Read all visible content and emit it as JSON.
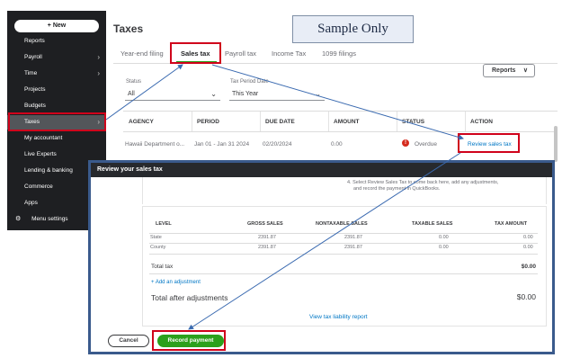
{
  "sidebar": {
    "new_label": "+ New",
    "items": [
      {
        "label": "Reports",
        "chevron": false
      },
      {
        "label": "Payroll",
        "chevron": true
      },
      {
        "label": "Time",
        "chevron": true
      },
      {
        "label": "Projects",
        "chevron": false
      },
      {
        "label": "Budgets",
        "chevron": false
      },
      {
        "label": "Taxes",
        "chevron": true,
        "active": true
      },
      {
        "label": "My accountant",
        "chevron": false
      },
      {
        "label": "Live Experts",
        "chevron": false
      },
      {
        "label": "Lending & banking",
        "chevron": false
      },
      {
        "label": "Commerce",
        "chevron": false
      },
      {
        "label": "Apps",
        "chevron": false
      }
    ],
    "menu_settings_label": "Menu settings",
    "chevron_glyph": "›",
    "gear_glyph": "⚙"
  },
  "page": {
    "title": "Taxes",
    "watermark": "Sample Only"
  },
  "tabs": [
    "Year-end filing",
    "Sales tax",
    "Payroll tax",
    "Income Tax",
    "1099 filings"
  ],
  "active_tab": "Sales tax",
  "reports_button": {
    "label": "Reports",
    "dropdown_glyph": "∨"
  },
  "filters": {
    "status": {
      "label": "Status",
      "value": "All"
    },
    "tax_period": {
      "label": "Tax Period Date",
      "value": "This Year"
    }
  },
  "table": {
    "headers": [
      "AGENCY",
      "PERIOD",
      "DUE DATE",
      "AMOUNT",
      "STATUS",
      "ACTION"
    ],
    "row": {
      "agency": "Hawaii Department o...",
      "period": "Jan 01 - Jan 31 2024",
      "due_date": "02/20/2024",
      "amount": "0.00",
      "status": "Overdue",
      "status_icon_glyph": "!",
      "action": "Review sales tax"
    }
  },
  "modal": {
    "title": "Review your sales tax",
    "instruction_line1": "4. Select Review Sales Tax to come back here, add any adjustments,",
    "instruction_line2": "and record the payment in QuickBooks.",
    "headers": [
      "LEVEL",
      "GROSS SALES",
      "NONTAXABLE SALES",
      "TAXABLE SALES",
      "TAX AMOUNT"
    ],
    "rows": [
      {
        "level": "State",
        "gross": "2391.87",
        "nontaxable": "2391.87",
        "taxable": "0.00",
        "tax": "0.00"
      },
      {
        "level": "County",
        "gross": "2391.87",
        "nontaxable": "2391.87",
        "taxable": "0.00",
        "tax": "0.00"
      }
    ],
    "total_tax_label": "Total tax",
    "total_tax_value": "$0.00",
    "add_adjustment": "+ Add an adjustment",
    "after_adjustments_label": "Total after adjustments",
    "after_adjustments_value": "$0.00",
    "liability_link": "View tax liability report",
    "cancel_label": "Cancel",
    "record_label": "Record payment"
  },
  "colors": {
    "highlight": "#d0021b",
    "arrow": "#3a6ab0",
    "brand_green": "#2ca01c",
    "link_blue": "#0077c5",
    "overdue_red": "#d52b1e"
  }
}
